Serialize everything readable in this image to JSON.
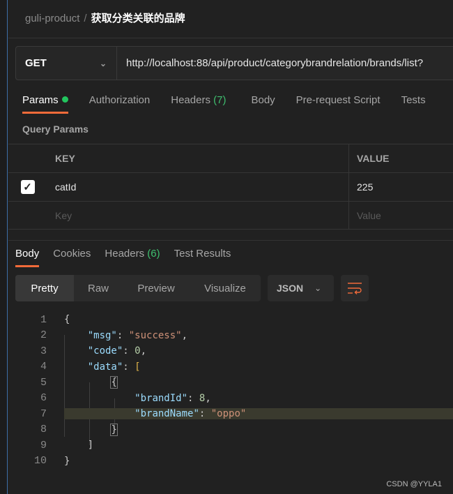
{
  "breadcrumb": {
    "collection": "guli-product",
    "separator": "/",
    "request": "获取分类关联的品牌"
  },
  "request": {
    "method": "GET",
    "url": "http://localhost:88/api/product/categorybrandrelation/brands/list?"
  },
  "request_tabs": [
    {
      "label": "Params",
      "active": true
    },
    {
      "label": "Authorization"
    },
    {
      "label": "Headers",
      "count": "(7)"
    },
    {
      "label": "Body"
    },
    {
      "label": "Pre-request Script"
    },
    {
      "label": "Tests"
    }
  ],
  "query_params": {
    "title": "Query Params",
    "headers": {
      "key": "KEY",
      "value": "VALUE"
    },
    "rows": [
      {
        "checked": true,
        "key": "catId",
        "value": "225"
      }
    ],
    "placeholder": {
      "key": "Key",
      "value": "Value"
    }
  },
  "response_tabs": [
    {
      "label": "Body",
      "active": true
    },
    {
      "label": "Cookies"
    },
    {
      "label": "Headers",
      "count": "(6)"
    },
    {
      "label": "Test Results"
    }
  ],
  "view_modes": [
    "Pretty",
    "Raw",
    "Preview",
    "Visualize"
  ],
  "format": "JSON",
  "code_lines": [
    "1",
    "2",
    "3",
    "4",
    "5",
    "6",
    "7",
    "8",
    "9",
    "10"
  ],
  "code": {
    "msg_key": "\"msg\"",
    "msg_val": "\"success\"",
    "code_key": "\"code\"",
    "code_val": "0",
    "data_key": "\"data\"",
    "brandId_key": "\"brandId\"",
    "brandId_val": "8",
    "brandName_key": "\"brandName\"",
    "brandName_val": "\"oppo\""
  },
  "watermark": "CSDN @YYLA1",
  "colors": {
    "accent": "#f26b3a",
    "green": "#22c55e"
  }
}
